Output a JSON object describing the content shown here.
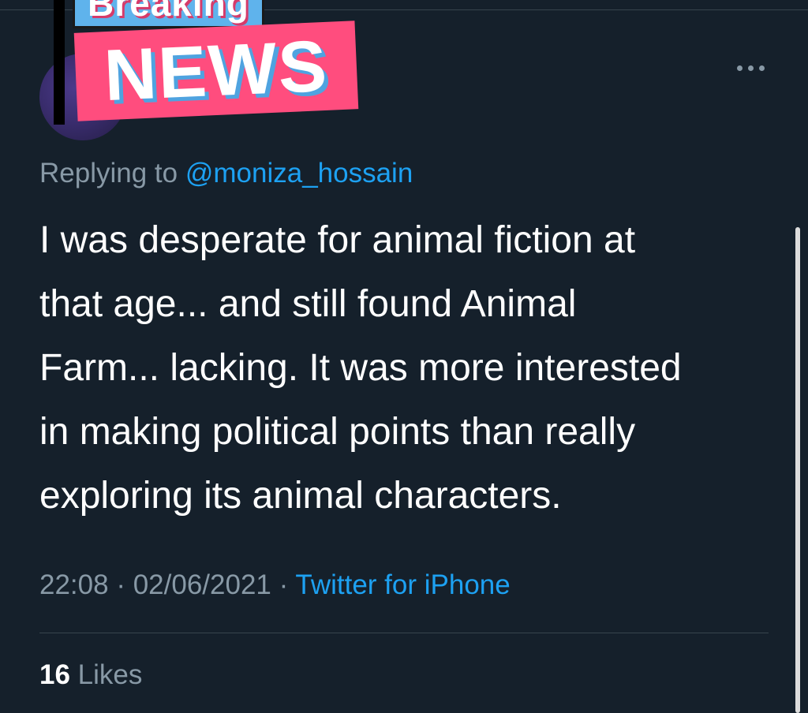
{
  "sticker": {
    "top_word": "Breaking",
    "main_word": "NEWS"
  },
  "tweet": {
    "replying_prefix": "Replying to",
    "replying_handle": "@moniza_hossain",
    "text_lines": [
      "I was desperate for animal fiction at",
      "that age... and still found Animal",
      "Farm... lacking. It was more interested",
      "in making political points than really",
      "exploring its animal characters."
    ],
    "time": "22:08",
    "date": "02/06/2021",
    "separator": "·",
    "source": "Twitter for iPhone",
    "likes_count": "16",
    "likes_label": "Likes"
  },
  "icons": {
    "more": "more-horizontal-icon"
  },
  "colors": {
    "background": "#15202b",
    "link": "#1da1f2",
    "muted": "#8899a6",
    "sticker_pink": "#ff4d7e",
    "sticker_blue": "#5fb3ec"
  }
}
